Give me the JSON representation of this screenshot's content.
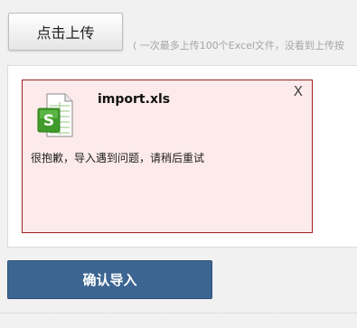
{
  "toolbar": {
    "upload_label": "点击上传",
    "hint": "( 一次最多上传100个Excel文件，没看到上传按"
  },
  "file": {
    "name": "import.xls",
    "close_label": "X",
    "error": "很抱歉，导入遇到问题，请稍后重试",
    "icon": "excel-file-icon"
  },
  "actions": {
    "confirm_label": "确认导入"
  },
  "colors": {
    "confirm_button": "#3c6591",
    "error_card_bg": "#fdeaea",
    "error_card_border": "#9e1f1f",
    "excel_green": "#3f9b2a"
  }
}
